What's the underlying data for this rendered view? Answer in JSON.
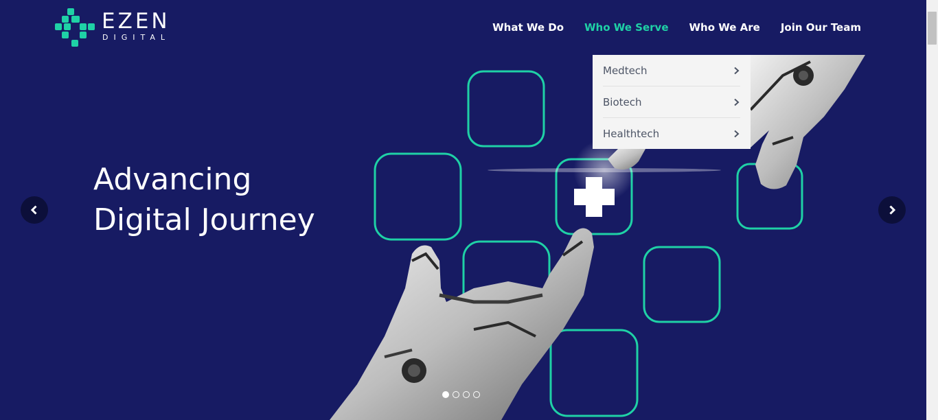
{
  "brand": {
    "name": "EZEN",
    "subtitle": "DIGITAL",
    "accent_color": "#1fd1a6",
    "background_color": "#171b63"
  },
  "nav": {
    "items": [
      {
        "label": "What We Do",
        "active": false
      },
      {
        "label": "Who We Serve",
        "active": true
      },
      {
        "label": "Who We Are",
        "active": false
      },
      {
        "label": "Join Our Team",
        "active": false
      }
    ]
  },
  "dropdown": {
    "items": [
      {
        "label": "Medtech",
        "icon": "chevron-right-icon"
      },
      {
        "label": "Biotech",
        "icon": "chevron-right-icon"
      },
      {
        "label": "Healthtech",
        "icon": "chevron-right-icon"
      }
    ]
  },
  "hero": {
    "title_line1": "Advancing",
    "title_line2": "Digital Journey"
  },
  "carousel": {
    "prev_icon": "chevron-left-icon",
    "next_icon": "chevron-right-icon",
    "slide_count": 4,
    "active_slide": 1
  }
}
